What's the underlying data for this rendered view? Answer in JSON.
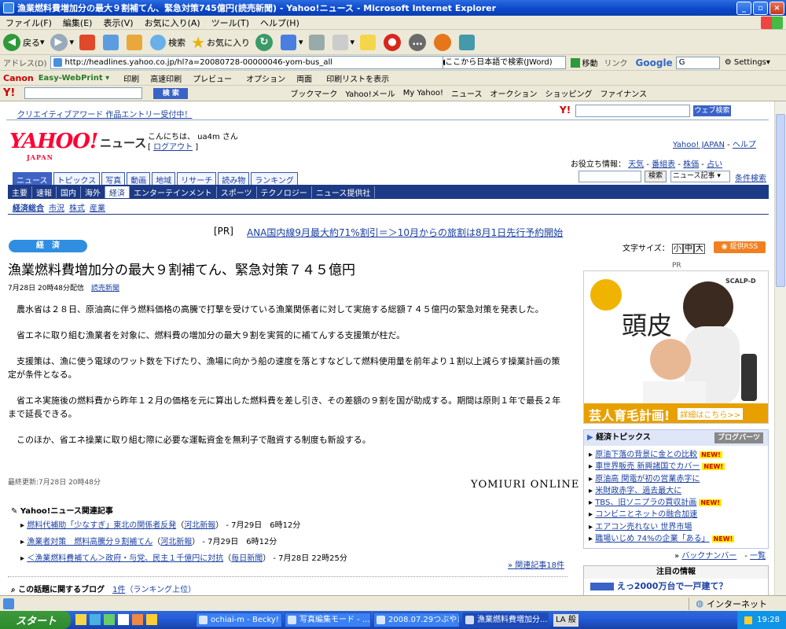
{
  "window": {
    "title": "漁業燃料費増加分の最大９割補てん、緊急対策745億円(読売新聞) - Yahoo!ニュース - Microsoft Internet Explorer",
    "menu": [
      "ファイル(F)",
      "編集(E)",
      "表示(V)",
      "お気に入り(A)",
      "ツール(T)",
      "ヘルプ(H)"
    ]
  },
  "toolbar": {
    "back_label": "戻る",
    "search_label": "検索",
    "favorites_label": "お気に入り"
  },
  "address": {
    "label": "アドレス(D)",
    "url": "http://headlines.yahoo.co.jp/hl?a=20080728-00000046-yom-bus_all",
    "jword": "◀ここから日本語で検索(JWord)",
    "go_label": "移動",
    "links_label": "リンク",
    "google": "Google",
    "google_box": "G",
    "settings": "Settings"
  },
  "linkbar": {
    "canon": "Canon",
    "easy": "Easy-WebPrint",
    "items": [
      "印刷",
      "高速印刷",
      "プレビュー",
      "オプション",
      "両面",
      "印刷リストを表示"
    ]
  },
  "ybar": {
    "search_btn": "検 索",
    "items": [
      "ブックマーク",
      "Yahoo!メール",
      "My Yahoo!",
      "ニュース",
      "オークション",
      "ショッピング",
      "ファイナンス"
    ]
  },
  "page": {
    "top_link": "クリエイティブアワード 作品エントリー受付中！",
    "web_search_btn": "ウェブ検索",
    "logo_main": "YAHOO!",
    "logo_sub": "JAPAN",
    "section_name": "ニュース",
    "greeting": "こんにちは、 ua4m さん",
    "logout": "ログアウト",
    "toplinks": [
      "Yahoo! JAPAN",
      "ヘルプ"
    ],
    "useful_label": "お役立ち情報：",
    "useful": [
      "天気",
      "番組表",
      "株価",
      "占い"
    ],
    "search_btn": "検索",
    "search_scope": "ニュース記事",
    "advanced": "条件検索",
    "tabs": [
      "ニュース",
      "トピックス",
      "写真",
      "動画",
      "地域",
      "リサーチ",
      "読み物",
      "ランキング"
    ],
    "nav": [
      "主要",
      "速報",
      "国内",
      "海外",
      "経済",
      "エンターテインメント",
      "スポーツ",
      "テクノロジー",
      "ニュース提供社"
    ],
    "subnav": [
      "経済総合",
      "市況",
      "株式",
      "産業"
    ],
    "pr_tag": "[PR]",
    "pr_text": "ANA国内線9月最大約71%割引＝＞10月からの旅割は8月1日先行予約開始",
    "category": "経　済",
    "headline": "漁業燃料費増加分の最大９割補てん、緊急対策７４５億円",
    "dateline": "7月28日 20時48分配信",
    "source": "読売新聞",
    "paragraphs": [
      "農水省は２８日、原油高に伴う燃料価格の高騰で打撃を受けている漁業関係者に対して実施する総額７４５億円の緊急対策を発表した。",
      "省エネに取り組む漁業者を対象に、燃料費の増加分の最大９割を実質的に補てんする支援策が柱だ。",
      "支援策は、漁に使う電球のワット数を下げたり、漁場に向かう船の速度を落とすなどして燃料使用量を前年より１割以上減らす操業計画の策定が条件となる。",
      "省エネ実施後の燃料費から昨年１２月の価格を元に算出した燃料費を差し引き、その差額の９割を国が助成する。期間は原則１年で最長２年まで延長できる。",
      "このほか、省エネ操業に取り組む際に必要な運転資金を無利子で融資する制度も新設する。"
    ],
    "last_updated": "最終更新:7月28日 20時48分",
    "yomiuri": "YOMIURI ONLINE",
    "related_title": "Yahoo!ニュース関連記事",
    "related": [
      {
        "title": "燃料代補助「少なすぎ」東北の関係者反発",
        "src": "河北新報",
        "date": "7月29日　6時12分"
      },
      {
        "title": "漁業者対策　燃料高騰分９割補てん",
        "src": "河北新報",
        "date": "7月29日　6時12分"
      },
      {
        "title": "＜漁業燃料費補てん＞政府・与党、民主１千億円に対抗",
        "src": "毎日新聞",
        "date": "7月28日 22時25分"
      }
    ],
    "related_more": "関連記事18件",
    "blog_title": "この話題に関するブログ",
    "blog_count": "1件",
    "blog_rank": "（ランキング上位）",
    "font_size_label": "文字サイズ：",
    "font_sizes": [
      "小",
      "中",
      "大"
    ],
    "rss": "提供RSS",
    "ad_pr": "PR",
    "ad_big": "頭皮",
    "ad_banner": "芸人育毛計画!",
    "ad_detail": "詳細はこちら>>",
    "ad_brand": "SCALP-D",
    "topics_title": "経済トピックス",
    "blog_parts": "ブログパーツ",
    "topics": [
      {
        "text": "原油下落の背景に金との比較",
        "new": true
      },
      {
        "text": "車世界販売 新興諸国でカバー",
        "new": true
      },
      {
        "text": "原油高 関電が初の営業赤字に",
        "new": false
      },
      {
        "text": "米財政赤字、過去最大に",
        "new": false
      },
      {
        "text": "TBS、旧ソニプラの買収計画",
        "new": true
      },
      {
        "text": "コンビニとネットの融合加速",
        "new": false
      },
      {
        "text": "エアコン売れない 世界市場",
        "new": false
      },
      {
        "text": "職場いじめ 74%の企業「ある」",
        "new": true
      }
    ],
    "new_label": "NEW!",
    "backnumber": "バックナンバー",
    "list_all": "一覧",
    "notice_title": "注目の情報",
    "notice_text": "えっ2000万台で一戸建て？"
  },
  "status": {
    "zone": "インターネット"
  },
  "taskbar": {
    "start": "スタート",
    "items": [
      "ochiai-m - Becky!",
      "写真編集モード - ...",
      "2008.07.29つぶやき...",
      "漁業燃料費増加分..."
    ],
    "ime": "LA 般",
    "clock": "19:28"
  }
}
